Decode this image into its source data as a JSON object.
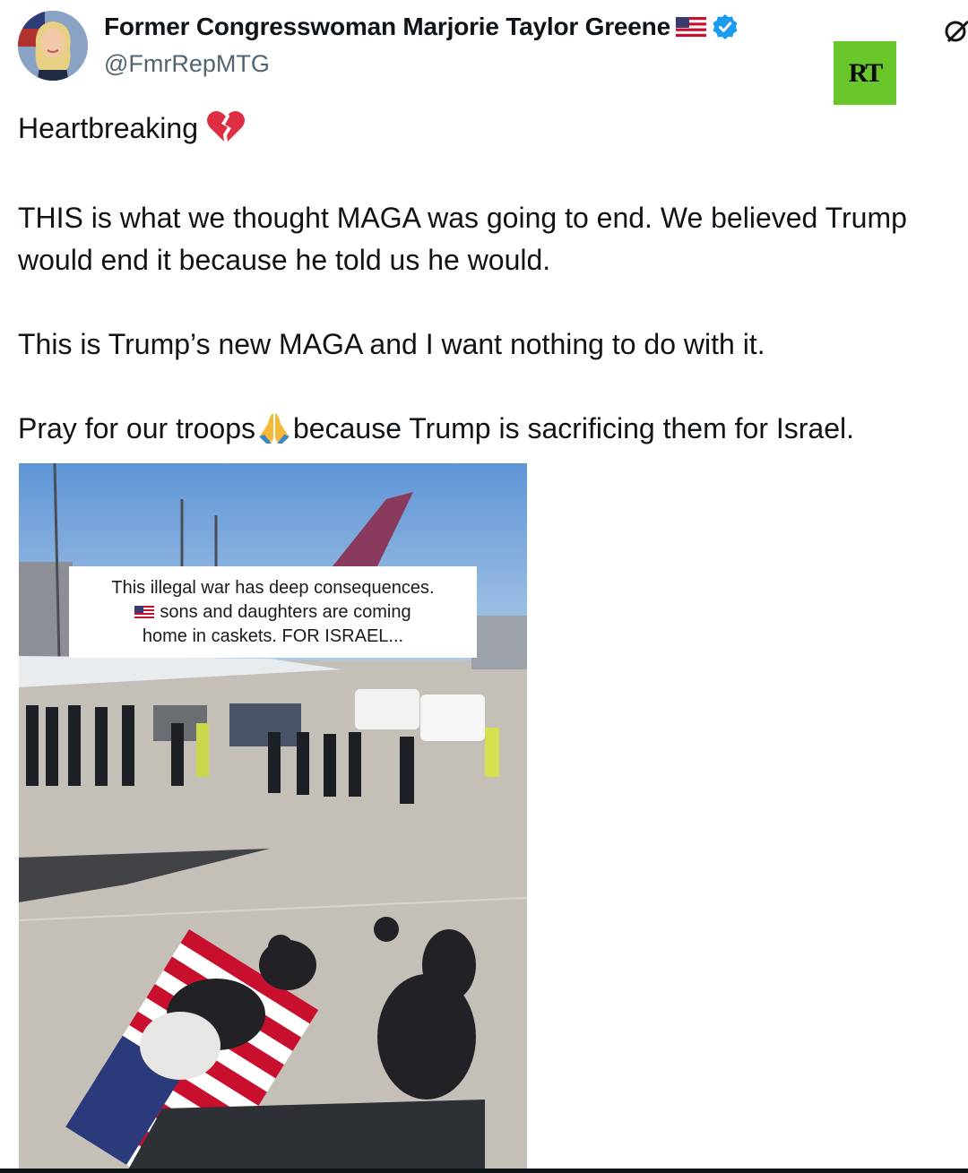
{
  "author": {
    "display_name": "Former Congresswoman Marjorie Taylor Greene",
    "handle": "@FmrRepMTG",
    "verified": true,
    "name_emoji": "us-flag-icon"
  },
  "watermark": {
    "logo_text": "RT",
    "color": "#6ac72b"
  },
  "tweet": {
    "line1": "Heartbreaking",
    "line1_emoji": "broken-heart-icon",
    "paragraph2_line1": "THIS is what we thought MAGA was going to end. We believed Trump",
    "paragraph2_line2": "would end it because he told us he would.",
    "paragraph3": "This is Trump’s new MAGA and I want nothing to do with it.",
    "paragraph4_before": "Pray for our troops",
    "paragraph4_emoji": "praying-hands-icon",
    "paragraph4_after": "because Trump is sacrificing them for Israel."
  },
  "media": {
    "caption_line1": "This illegal war has deep consequences.",
    "caption_line2": "sons and daughters are coming",
    "caption_line3": "home in caskets. FOR ISRAEL..."
  },
  "colors": {
    "verified_blue": "#1d9bf0",
    "heart_red": "#dd2e44",
    "handle_gray": "#536471"
  }
}
